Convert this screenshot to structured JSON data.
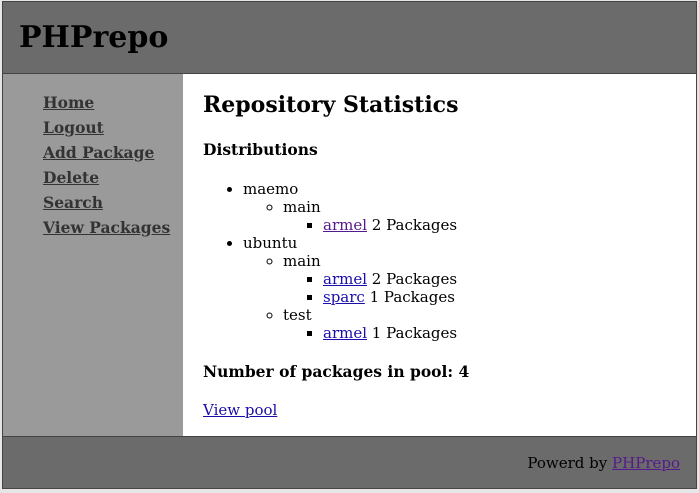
{
  "site": {
    "title": "PHPrepo"
  },
  "sidebar": {
    "items": [
      {
        "label": "Home"
      },
      {
        "label": "Logout"
      },
      {
        "label": "Add Package"
      },
      {
        "label": "Delete"
      },
      {
        "label": "Search"
      },
      {
        "label": "View Packages"
      }
    ]
  },
  "main": {
    "title": "Repository Statistics",
    "distributions_heading": "Distributions",
    "distributions": [
      {
        "name": "maemo",
        "components": [
          {
            "name": "main",
            "archs": [
              {
                "name": "armel",
                "count_text": "2 Packages"
              }
            ]
          }
        ]
      },
      {
        "name": "ubuntu",
        "components": [
          {
            "name": "main",
            "archs": [
              {
                "name": "armel",
                "count_text": "2 Packages"
              },
              {
                "name": "sparc",
                "count_text": "1 Packages"
              }
            ]
          },
          {
            "name": "test",
            "archs": [
              {
                "name": "armel",
                "count_text": "1 Packages"
              }
            ]
          }
        ]
      }
    ],
    "pool_label": "Number of packages in pool:",
    "pool_count": "4",
    "view_pool_label": "View pool"
  },
  "footer": {
    "prefix": "Powerd by",
    "link_label": "PHPrepo"
  }
}
